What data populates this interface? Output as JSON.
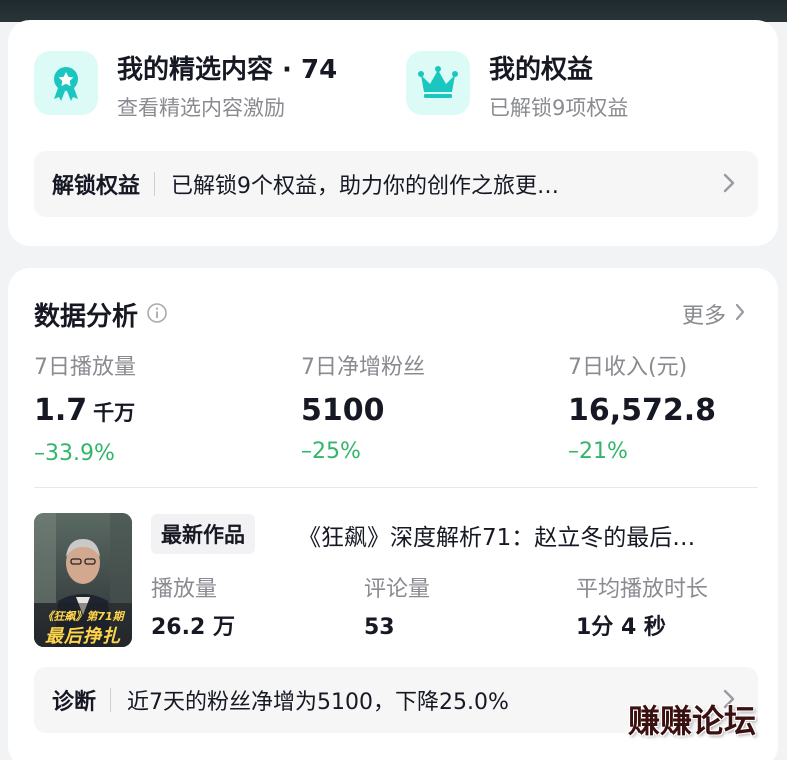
{
  "colors": {
    "accent_teal": "#19c6c0",
    "positive_green": "#33b56b",
    "muted_text": "#8a8b91"
  },
  "selected": {
    "title": "我的精选内容 · 74",
    "subtitle": "查看精选内容激励",
    "icon": "medal-star-icon"
  },
  "rights": {
    "title": "我的权益",
    "subtitle": "已解锁9项权益",
    "icon": "crown-icon"
  },
  "unlock_bar": {
    "label": "解锁权益",
    "text": "已解锁9个权益，助力你的创作之旅更…"
  },
  "analytics": {
    "title": "数据分析",
    "more": "更多",
    "stats": [
      {
        "label": "7日播放量",
        "value": "1.7",
        "unit": "千万",
        "change": "–33.9%"
      },
      {
        "label": "7日净增粉丝",
        "value": "5100",
        "unit": "",
        "change": "–25%"
      },
      {
        "label": "7日收入(元)",
        "value": "16,572.8",
        "unit": "",
        "change": "–21%"
      }
    ]
  },
  "latest_work": {
    "tag": "最新作品",
    "title": "《狂飙》深度解析71：赵立冬的最后…",
    "thumb_caption_top": "《狂飙》第71期",
    "thumb_caption_bottom": "最后挣扎",
    "stats": [
      {
        "label": "播放量",
        "value": "26.2 万"
      },
      {
        "label": "评论量",
        "value": "53"
      },
      {
        "label": "平均播放时长",
        "value": "1分 4 秒"
      }
    ]
  },
  "diagnosis": {
    "label": "诊断",
    "text": "近7天的粉丝净增为5100，下降25.0%"
  },
  "overlay_text": "赚赚论坛"
}
